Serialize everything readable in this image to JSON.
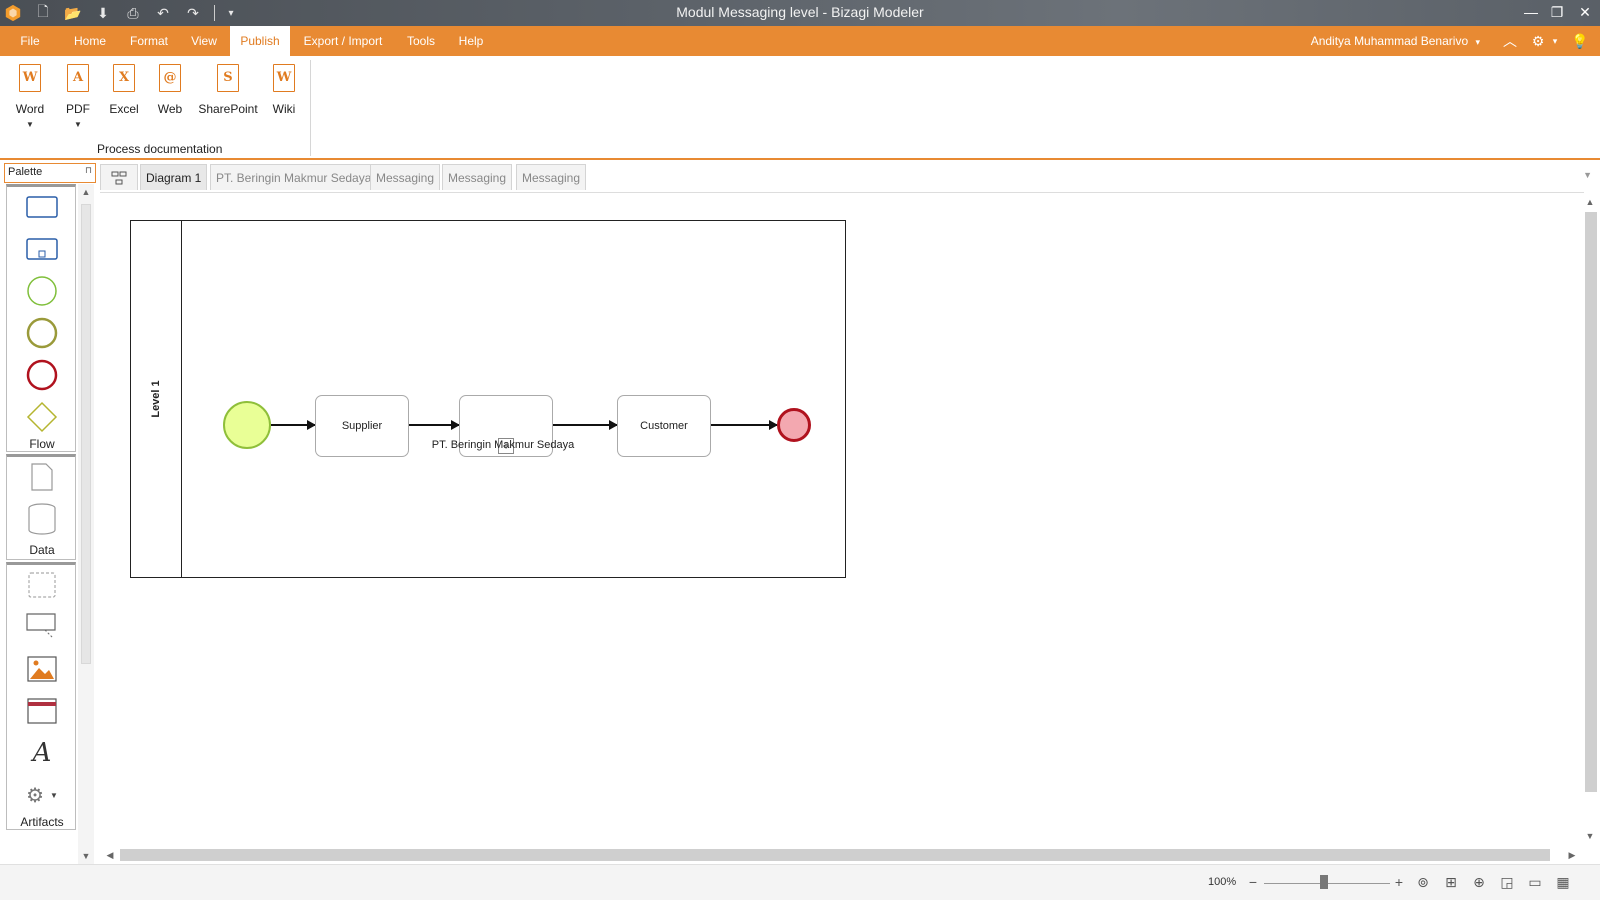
{
  "window": {
    "title": "Modul Messaging level - Bizagi Modeler",
    "minimize": "—",
    "restore": "❐",
    "close": "✕"
  },
  "quick_access": [
    {
      "icon": "new-file-icon",
      "glyph": "🗋"
    },
    {
      "icon": "open-folder-icon",
      "glyph": "📂"
    },
    {
      "icon": "save-icon",
      "glyph": "⬇"
    },
    {
      "icon": "print-icon",
      "glyph": "⎙"
    },
    {
      "icon": "undo-icon",
      "glyph": "↶"
    },
    {
      "icon": "redo-icon",
      "glyph": "↷"
    },
    {
      "icon": "customize-icon",
      "glyph": "▾"
    }
  ],
  "ribbon_tabs": [
    {
      "label": "File",
      "active": false
    },
    {
      "label": "Home",
      "active": false
    },
    {
      "label": "Format",
      "active": false
    },
    {
      "label": "View",
      "active": false
    },
    {
      "label": "Publish",
      "active": true
    },
    {
      "label": "Export / Import",
      "active": false
    },
    {
      "label": "Tools",
      "active": false
    },
    {
      "label": "Help",
      "active": false
    }
  ],
  "user": {
    "name": "Anditya Muhammad Benarivo",
    "menu_glyph": "▾"
  },
  "ribbon_icons": {
    "collapse": "︿",
    "settings": "⚙",
    "settings_caret": "▾",
    "help": "💡"
  },
  "publish_buttons": [
    {
      "label": "Word",
      "letter": "W",
      "has_dropdown": true
    },
    {
      "label": "PDF",
      "letter": "A",
      "has_dropdown": true
    },
    {
      "label": "Excel",
      "letter": "X",
      "has_dropdown": false
    },
    {
      "label": "Web",
      "letter": "@",
      "has_dropdown": false
    },
    {
      "label": "SharePoint",
      "letter": "S",
      "has_dropdown": false
    },
    {
      "label": "Wiki",
      "letter": "W",
      "has_dropdown": false
    }
  ],
  "ribbon_group_label": "Process documentation",
  "palette": {
    "title": "Palette",
    "pin_glyph": "⊓",
    "groups": [
      {
        "label": "Flow"
      },
      {
        "label": "Data"
      },
      {
        "label": "Artifacts"
      }
    ]
  },
  "diagram_tabs": [
    {
      "label": "Diagram 1",
      "active": true
    },
    {
      "label": "PT. Beringin Makmur Sedaya",
      "active": false
    },
    {
      "label": "Messaging",
      "active": false
    },
    {
      "label": "Messaging",
      "active": false
    },
    {
      "label": "Messaging",
      "active": false
    }
  ],
  "diagram": {
    "lane_label": "Level 1",
    "tasks": [
      {
        "label": "Supplier"
      },
      {
        "label": ""
      },
      {
        "label": "Customer"
      }
    ],
    "subprocess_caption": "PT. Beringin Makmur Sedaya",
    "subprocess_marker": "+",
    "colors": {
      "start_fill": "#e9ff96",
      "start_stroke": "#8fbf3a",
      "end_fill": "#f3a8b0",
      "end_stroke": "#b0121e"
    }
  },
  "statusbar": {
    "zoom": "100%",
    "zoom_minus": "−",
    "zoom_plus": "+",
    "icons": [
      {
        "icon": "zoom-fit-icon",
        "glyph": "⊚"
      },
      {
        "icon": "fit-page-icon",
        "glyph": "⊞"
      },
      {
        "icon": "zoom-in-icon",
        "glyph": "⊕"
      },
      {
        "icon": "zoom-area-icon",
        "glyph": "◲"
      },
      {
        "icon": "presentation-icon",
        "glyph": "▭"
      },
      {
        "icon": "overview-icon",
        "glyph": "▦"
      }
    ]
  },
  "accent_color": "#e88a33"
}
